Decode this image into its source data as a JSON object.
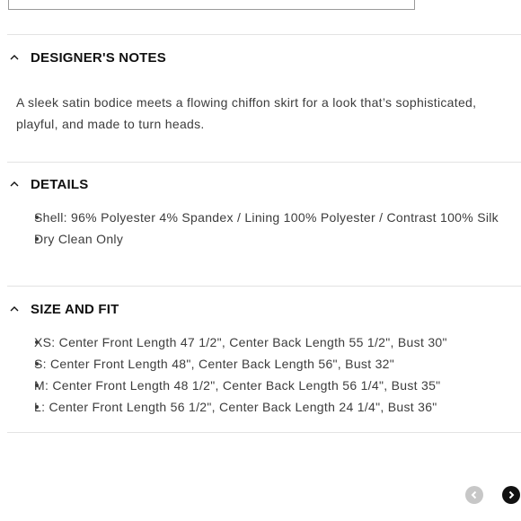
{
  "sections": [
    {
      "title": "DESIGNER'S NOTES",
      "text": "A sleek satin bodice meets a flowing chiffon skirt for a look that’s sophisticated, playful, and made to turn heads."
    },
    {
      "title": "DETAILS",
      "items": [
        "Shell: 96% Polyester 4% Spandex / Lining 100% Polyester / Contrast 100% Silk",
        "Dry Clean Only"
      ]
    },
    {
      "title": "SIZE AND FIT",
      "items": [
        "XS: Center Front Length 47 1/2\", Center Back Length 55 1/2\", Bust 30\"",
        "S: Center Front Length 48\", Center Back Length 56\", Bust 32\"",
        "M: Center Front Length 48 1/2\", Center Back Length 56 1/4\", Bust 35\"",
        "L: Center Front Length 56 1/2\", Center Back Length 24 1/4\", Bust 36\""
      ]
    }
  ],
  "icons": {
    "section_toggle": "chevron-up-icon",
    "prev": "chevron-left-icon",
    "next": "chevron-right-icon"
  },
  "colors": {
    "heading": "#111111",
    "body_text": "#3c3c3c",
    "divider": "#e3e3e3",
    "prev_disabled": "#c7c7c7",
    "next_active": "#111111"
  }
}
